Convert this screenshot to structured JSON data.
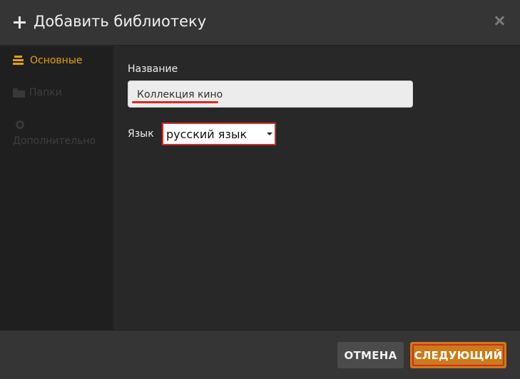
{
  "header": {
    "title": "Добавить библиотеку",
    "icon": "plus-icon",
    "close_icon": "close-icon"
  },
  "sidebar": {
    "items": [
      {
        "label": "Основные",
        "icon": "lines-icon",
        "active": true
      },
      {
        "label": "Папки",
        "icon": "folder-icon",
        "active": false
      },
      {
        "label": "Дополнительно",
        "icon": "gear-icon",
        "active": false
      }
    ]
  },
  "form": {
    "name_label": "Название",
    "name_value": "Коллекция кино",
    "language_label": "Язык",
    "language_value": "русский язык"
  },
  "footer": {
    "cancel_label": "ОТМЕНА",
    "next_label": "СЛЕДУЮЩИЙ"
  },
  "colors": {
    "accent": "#e5a00d",
    "next_button": "#cc7b19",
    "highlight": "#d62a2a"
  }
}
